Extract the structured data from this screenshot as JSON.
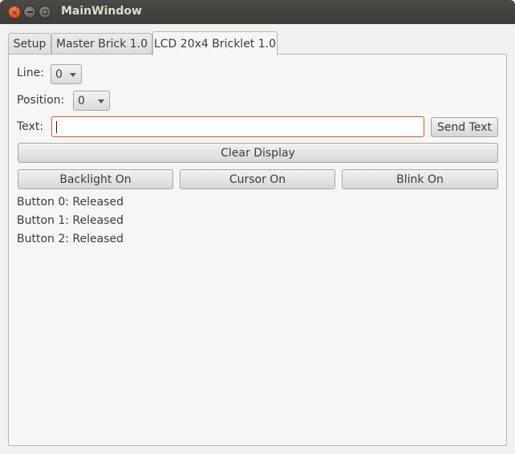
{
  "window": {
    "title": "MainWindow"
  },
  "tabs": [
    {
      "label": "Setup"
    },
    {
      "label": "Master Brick 1.0"
    },
    {
      "label": "LCD 20x4 Bricklet 1.0"
    }
  ],
  "form": {
    "line_label": "Line:",
    "line_value": "0",
    "position_label": "Position:",
    "position_value": "0",
    "text_label": "Text:",
    "text_value": "",
    "send_text_label": "Send Text",
    "clear_display_label": "Clear Display",
    "backlight_label": "Backlight On",
    "cursor_label": "Cursor On",
    "blink_label": "Blink On"
  },
  "buttons_status": [
    "Button 0: Released",
    "Button 1: Released",
    "Button 2: Released"
  ]
}
